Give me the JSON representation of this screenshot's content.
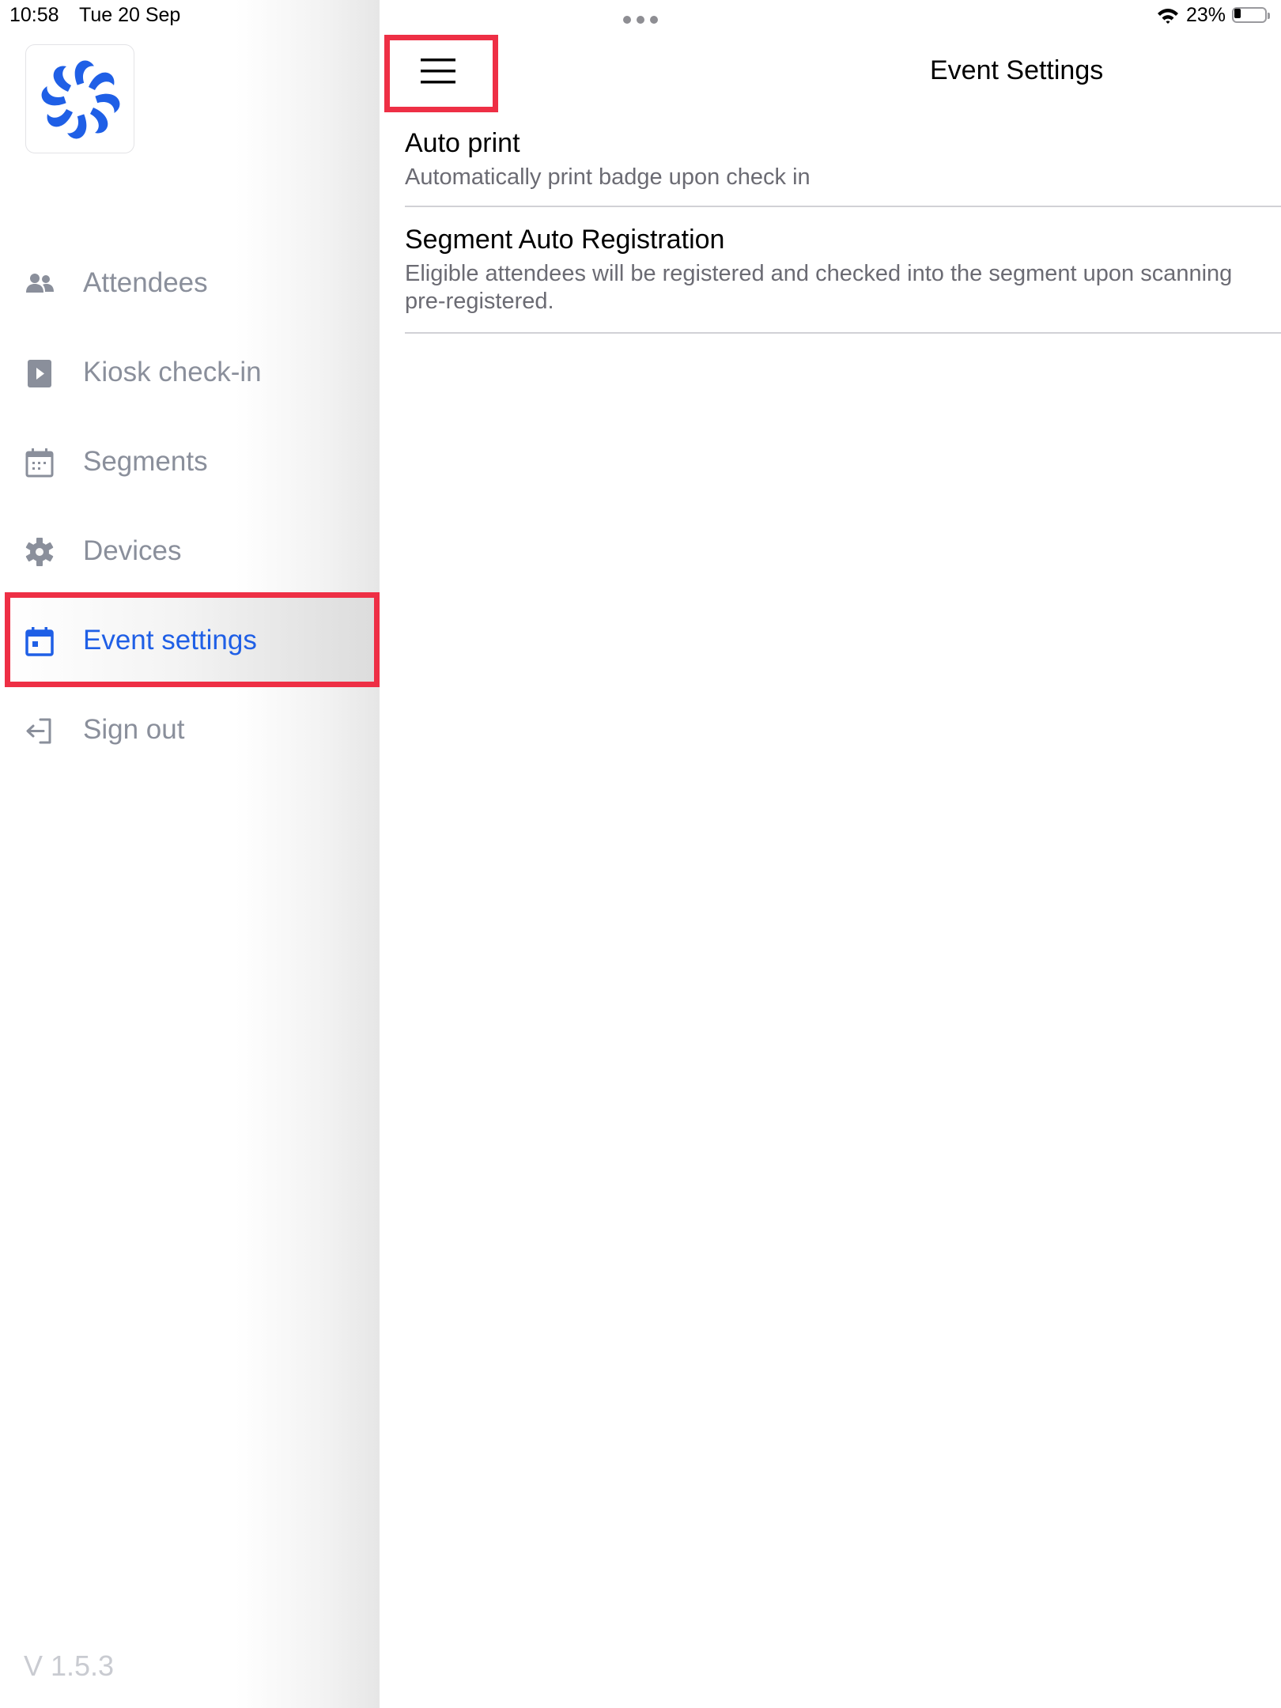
{
  "status_bar": {
    "time": "10:58",
    "date": "Tue 20 Sep",
    "battery_percent": "23%",
    "battery_level": 0.23,
    "wifi_icon": "wifi-icon",
    "battery_icon": "battery-icon"
  },
  "sidebar": {
    "logo_icon": "app-logo",
    "items": [
      {
        "label": "Attendees",
        "icon": "people-icon",
        "active": false
      },
      {
        "label": "Kiosk check-in",
        "icon": "play-icon",
        "active": false
      },
      {
        "label": "Segments",
        "icon": "calendar-grid-icon",
        "active": false
      },
      {
        "label": "Devices",
        "icon": "gear-icon",
        "active": false
      },
      {
        "label": "Event settings",
        "icon": "calendar-event-icon",
        "active": true
      },
      {
        "label": "Sign out",
        "icon": "sign-out-icon",
        "active": false
      }
    ],
    "version": "V 1.5.3"
  },
  "header": {
    "menu_icon": "hamburger-icon",
    "title": "Event Settings"
  },
  "settings": [
    {
      "title": "Auto print",
      "description": "Automatically print badge upon check in"
    },
    {
      "title": "Segment Auto Registration",
      "description_line1": "Eligible attendees will be registered and checked into the segment upon scanning",
      "description_line2": "pre-registered."
    }
  ],
  "colors": {
    "accent": "#1f5fe6",
    "nav_inactive": "#8a8f9b",
    "highlight_outline": "#ee2f45"
  }
}
